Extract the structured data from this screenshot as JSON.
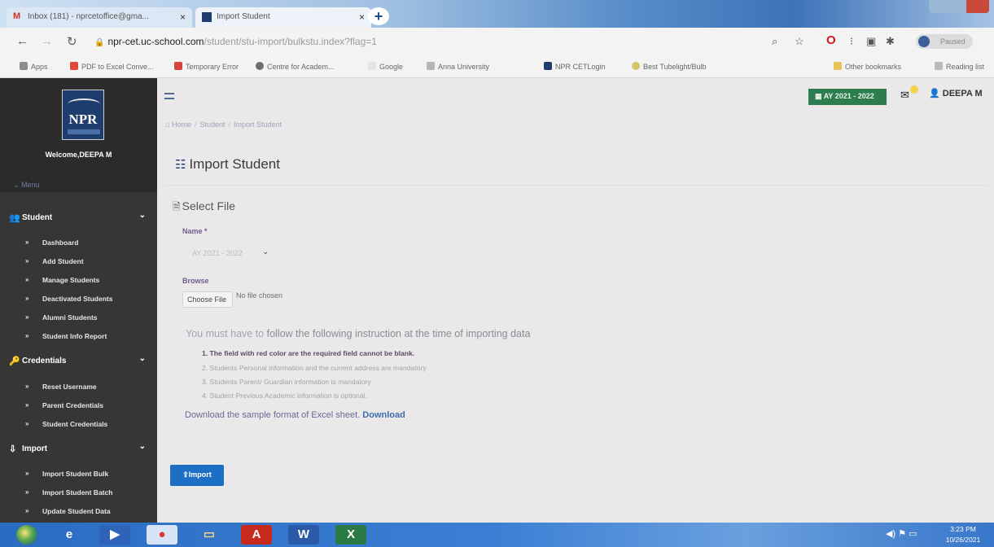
{
  "browser": {
    "tabs": [
      {
        "title": "Inbox (181) - nprcetoffice@gma..."
      },
      {
        "title": "Import Student"
      }
    ],
    "url": {
      "host": "npr-cet.uc-school.com",
      "path": "/student/stu-import/bulkstu.index?flag=1"
    },
    "profile_label": "Paused",
    "bookmarks": [
      "Apps",
      "PDF to Excel Conve...",
      "Temporary Error",
      "Centre for Academ...",
      "Google",
      "Anna University",
      "NPR CETLogin",
      "Best Tubelight/Bulb",
      "Other bookmarks",
      "Reading list"
    ]
  },
  "sidebar": {
    "logo_text": "NPR",
    "welcome": "Welcome,DEEPA M",
    "menu_toggle": "Menu",
    "sections": [
      {
        "label": "Student",
        "items": [
          "Dashboard",
          "Add Student",
          "Manage Students",
          "Deactivated Students",
          "Alumni Students",
          "Student Info Report"
        ]
      },
      {
        "label": "Credentials",
        "items": [
          "Reset Username",
          "Parent Credentials",
          "Student Credentials"
        ]
      },
      {
        "label": "Import",
        "items": [
          "Import Student Bulk",
          "Import Student Batch",
          "Update Student Data"
        ]
      }
    ]
  },
  "header": {
    "academic_year": "AY 2021 - 2022",
    "user": "DEEPA M"
  },
  "breadcrumb": [
    "Home",
    "Student",
    "Import Student"
  ],
  "page": {
    "title": "Import Student",
    "section_title": "Select File",
    "name_label": "Name *",
    "name_value": "AY 2021 - 2022",
    "browse_label": "Browse",
    "choose_file": "Choose File",
    "no_file": "No file chosen",
    "instruction_head_light": "You must have to",
    "instruction_head_dark": "follow the following instruction at the time of importing data",
    "instructions": [
      "1. The field with red color are the required field cannot be blank.",
      "2. Students Personal information and the current address are mandatory",
      "3. Students Parent/ Guardian information is mandatory",
      "4. Student Previous Academic information is optional."
    ],
    "download_text": "Download the sample format of Excel sheet.",
    "download_link": "Download",
    "import_button": "Import"
  },
  "taskbar": {
    "time": "3:23 PM",
    "date": "10/26/2021"
  }
}
